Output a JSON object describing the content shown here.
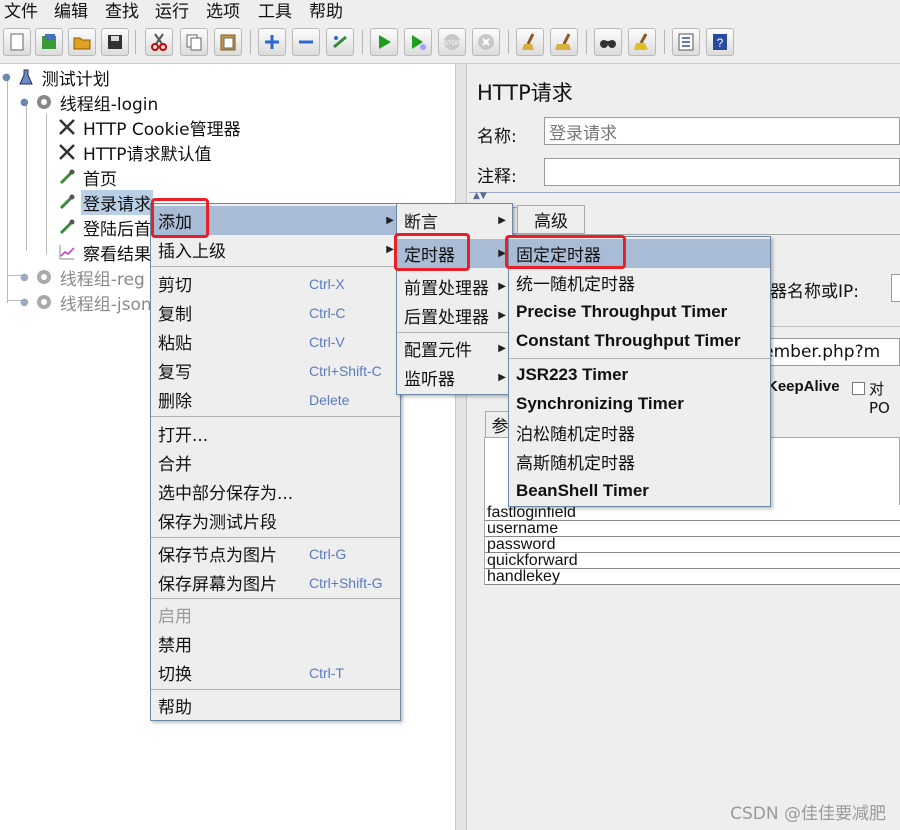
{
  "menubar": {
    "items": [
      "文件",
      "编辑",
      "查找",
      "运行",
      "选项",
      "工具",
      "帮助"
    ]
  },
  "toolbar": {
    "buttons": [
      "new-icon",
      "templates-icon",
      "open-icon",
      "save-icon",
      "cut-icon",
      "copy-icon",
      "paste-icon",
      "expand-icon",
      "collapse-icon",
      "toggle-icon",
      "start-icon",
      "start-no-pause-icon",
      "stop-icon",
      "shutdown-icon",
      "clear-icon",
      "clear-all-icon",
      "search-icon",
      "reset-search-icon",
      "function-helper-icon",
      "help-icon"
    ]
  },
  "tree": {
    "nodes": [
      {
        "label": "测试计划",
        "icon": "flask-icon"
      },
      {
        "label": "线程组-login",
        "icon": "gear-icon"
      },
      {
        "label": "HTTP Cookie管理器",
        "icon": "wrench-icon"
      },
      {
        "label": "HTTP请求默认值",
        "icon": "wrench-icon"
      },
      {
        "label": "首页",
        "icon": "pipette-icon"
      },
      {
        "label": "登录请求",
        "icon": "pipette-icon"
      },
      {
        "label": "登陆后首",
        "icon": "pipette-icon"
      },
      {
        "label": "察看结果",
        "icon": "chart-icon"
      },
      {
        "label": "线程组-reg",
        "icon": "gear-icon"
      },
      {
        "label": "线程组-json",
        "icon": "gear-icon"
      }
    ]
  },
  "editor": {
    "title": "HTTP请求",
    "name_label": "名称:",
    "name_value": "登录请求",
    "comment_label": "注释:",
    "comment_value": "",
    "tab_advanced": "高级",
    "server_label": "器名称或IP:",
    "path_fragment": "s/member.php?m",
    "keepalive_label": "KeepAlive",
    "multipart_label": "对PO",
    "params_tab": "参",
    "params": [
      "fastloginfield",
      "username",
      "password",
      "quickforward",
      "handlekey"
    ]
  },
  "context_menu": {
    "items": [
      {
        "label": "添加",
        "shortcut": "",
        "submenu": true,
        "highlighted": true
      },
      {
        "label": "插入上级",
        "shortcut": "",
        "submenu": true
      },
      {
        "label": "剪切",
        "shortcut": "Ctrl-X"
      },
      {
        "label": "复制",
        "shortcut": "Ctrl-C"
      },
      {
        "label": "粘贴",
        "shortcut": "Ctrl-V"
      },
      {
        "label": "复写",
        "shortcut": "Ctrl+Shift-C"
      },
      {
        "label": "删除",
        "shortcut": "Delete"
      },
      {
        "label": "打开...",
        "shortcut": ""
      },
      {
        "label": "合并",
        "shortcut": ""
      },
      {
        "label": "选中部分保存为...",
        "shortcut": ""
      },
      {
        "label": "保存为测试片段",
        "shortcut": ""
      },
      {
        "label": "保存节点为图片",
        "shortcut": "Ctrl-G"
      },
      {
        "label": "保存屏幕为图片",
        "shortcut": "Ctrl+Shift-G"
      },
      {
        "label": "启用",
        "shortcut": "",
        "disabled": true
      },
      {
        "label": "禁用",
        "shortcut": ""
      },
      {
        "label": "切换",
        "shortcut": "Ctrl-T"
      },
      {
        "label": "帮助",
        "shortcut": ""
      }
    ]
  },
  "add_submenu": {
    "items": [
      "断言",
      "定时器",
      "前置处理器",
      "后置处理器",
      "配置元件",
      "监听器"
    ]
  },
  "timer_submenu": {
    "items": [
      "固定定时器",
      "统一随机定时器",
      "Precise Throughput Timer",
      "Constant Throughput Timer",
      "JSR223 Timer",
      "Synchronizing Timer",
      "泊松随机定时器",
      "高斯随机定时器",
      "BeanShell Timer"
    ]
  },
  "watermark": "CSDN @佳佳要减肥",
  "colors": {
    "highlight": "#a9bcd6",
    "annotation": "#e8202a",
    "shortcut": "#5a7bbf",
    "selection": "#b8cfe5"
  }
}
